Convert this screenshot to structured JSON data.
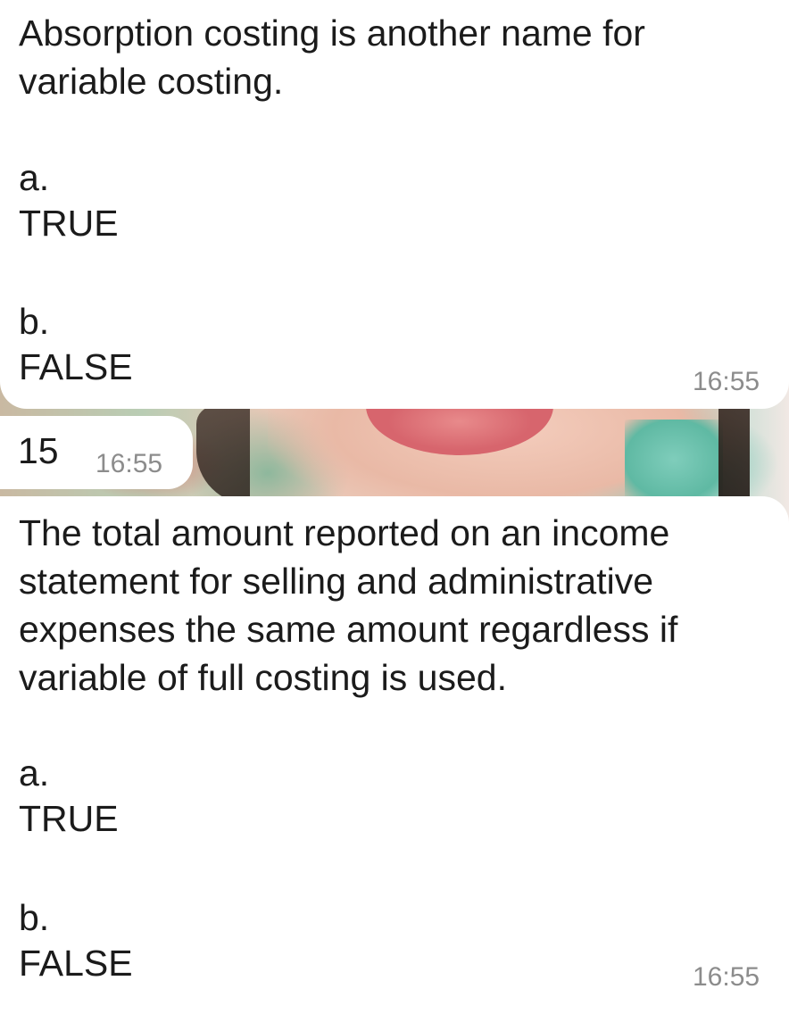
{
  "messages": [
    {
      "text": "Absorption costing is another name for variable costing.",
      "options": [
        {
          "letter": "a.",
          "value": "TRUE"
        },
        {
          "letter": "b.",
          "value": "FALSE"
        }
      ],
      "time": "16:55"
    },
    {
      "text": "15",
      "time": "16:55"
    },
    {
      "text": "The total amount reported on an income statement for selling and administrative expenses the same amount regardless if variable of full costing is used.",
      "options": [
        {
          "letter": "a.",
          "value": "TRUE"
        },
        {
          "letter": "b.",
          "value": "FALSE"
        }
      ],
      "time": "16:55"
    }
  ],
  "colors": {
    "bubble": "#ffffff",
    "text": "#1b1b1b",
    "timestamp": "#8c8c8c"
  }
}
